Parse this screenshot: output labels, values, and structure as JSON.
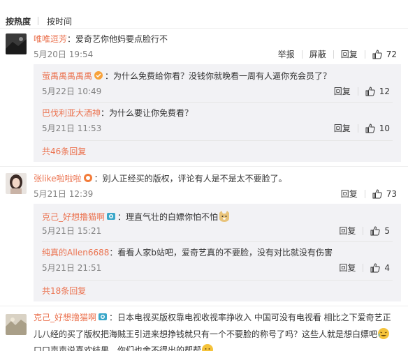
{
  "sort": {
    "hot": "按热度",
    "time": "按时间"
  },
  "actions": {
    "report": "举报",
    "block": "屏蔽",
    "reply": "回复"
  },
  "comments": [
    {
      "user": "唯唯逗芳",
      "text": "：爱奇艺你他妈要点脸行不",
      "time": "5月20日 19:54",
      "likes": "72",
      "replies": [
        {
          "user": "萤禹禹禹禹禹",
          "text": "：为什么免费给你看？没钱你就晚看一周有人逼你充会员了？",
          "time": "5月22日 10:49",
          "likes": "12"
        },
        {
          "user": "巴伐利亚大酒神",
          "text": "：为什么要让你免费看？",
          "time": "5月21日 11:53",
          "likes": "10"
        }
      ],
      "more": "共46条回复"
    },
    {
      "user": "张like啦啦啦",
      "text": "：别人正经买的版权，评论有人是不是太不要脸了。",
      "time": "5月21日 12:39",
      "likes": "73",
      "replies": [
        {
          "user": "克己_好想撸猫啊",
          "text": "：理直气壮的白嫖你怕不怕",
          "time": "5月21日 15:21",
          "likes": "5"
        },
        {
          "user": "纯真的Allen6688",
          "text": "：看看人家b站吧，爱奇艺真的不要脸，没有对比就没有伤害",
          "time": "5月21日 21:51",
          "likes": "4"
        }
      ],
      "more": "共18条回复"
    },
    {
      "user": "克己_好想撸猫啊",
      "text": "：日本电视买版权靠电视收视率挣收入 中国可没有电视看 相比之下爱奇艺正",
      "text2": "儿八经的买了版权把海贼王引进来想挣钱就只有一个不要脸的称号了吗？这些人就是想白嫖吧",
      "text3": "口口声声说喜欢结果，你们也舍不得出的帮帮"
    }
  ],
  "colors": {
    "username": "#eb7350",
    "meta": "#808080",
    "reply_bg": "#f2f2f5"
  }
}
